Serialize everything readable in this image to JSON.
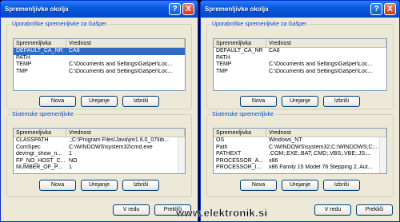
{
  "windows": [
    {
      "title": "Spremenljivke okolja",
      "help_glyph": "?",
      "close_glyph": "X",
      "user": {
        "legend": "Uporabniške spremenljivke za Gašper",
        "headers": [
          "Spremenljivka",
          "Vrednost"
        ],
        "rows": [
          {
            "name": "DEFAULT_CA_NR",
            "value": "CA8",
            "selected": true
          },
          {
            "name": "PATH",
            "value": ""
          },
          {
            "name": "TEMP",
            "value": "C:\\Documents and Settings\\Gašper\\Loc..."
          },
          {
            "name": "TMP",
            "value": "C:\\Documents and Settings\\Gašper\\Loc..."
          }
        ],
        "buttons": [
          "Nova",
          "Urejanje",
          "Izbriši"
        ]
      },
      "system": {
        "legend": "Sistemske spremenljivke",
        "headers": [
          "Spremenljivka",
          "Vrednost"
        ],
        "rows": [
          {
            "name": "CLASSPATH",
            "value": ".;C:\\Program Files\\Java\\jre1.6.0_07\\lib..."
          },
          {
            "name": "ComSpec",
            "value": "C:\\WINDOWS\\system32\\cmd.exe"
          },
          {
            "name": "devmgr_show_n...",
            "value": "1"
          },
          {
            "name": "FP_NO_HOST_C...",
            "value": "NO"
          },
          {
            "name": "NUMBER_OF_P...",
            "value": "1"
          }
        ],
        "buttons": [
          "Nova",
          "Urejanje",
          "Izbriši"
        ]
      },
      "footer": {
        "ok": "V redu",
        "cancel": "Prekliči"
      }
    },
    {
      "title": "Spremenljivke okolja",
      "help_glyph": "?",
      "close_glyph": "X",
      "user": {
        "legend": "Uporabniške spremenljivke za Gašper",
        "headers": [
          "Spremenljivka",
          "Vrednost"
        ],
        "rows": [
          {
            "name": "DEFAULT_CA_NR",
            "value": "CA8"
          },
          {
            "name": "PATH",
            "value": ""
          },
          {
            "name": "TEMP",
            "value": "C:\\Documents and Settings\\Gašper\\Loc..."
          },
          {
            "name": "TMP",
            "value": "C:\\Documents and Settings\\Gašper\\Loc..."
          }
        ],
        "buttons": [
          "Nova",
          "Urejanje",
          "Izbriši"
        ]
      },
      "system": {
        "legend": "Sistemske spremenljivke",
        "headers": [
          "Spremenljivka",
          "Vrednost"
        ],
        "rows": [
          {
            "name": "OS",
            "value": "Windows_NT"
          },
          {
            "name": "Path",
            "value": "C:\\WINDOWS\\system32;C:\\WINDOWS;C:..."
          },
          {
            "name": "PATHEXT",
            "value": ".COM;.EXE;.BAT;.CMD;.VBS;.VBE;.JS;..."
          },
          {
            "name": "PROCESSOR_A...",
            "value": "x86"
          },
          {
            "name": "PROCESSOR_I...",
            "value": "x86 Family 15 Model 76 Stepping 2, Aut..."
          }
        ],
        "buttons": [
          "Nova",
          "Urejanje",
          "Izbriši"
        ]
      },
      "footer": {
        "ok": "V redu",
        "cancel": "Prekliči"
      }
    }
  ],
  "watermark": "www.elektronik.si",
  "colors": {
    "titlebar": "#0a5ae0",
    "selection": "#316ac5",
    "legend": "#0046d5",
    "window_bg": "#ece9d8"
  }
}
